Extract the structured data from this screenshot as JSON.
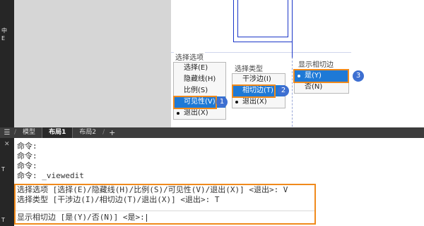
{
  "left_strip": {
    "glyphs": [
      "中",
      "E",
      "T",
      "T"
    ]
  },
  "menus": {
    "select_options": {
      "caption": "选择选项",
      "items": [
        {
          "label": "选择(E)",
          "selected": false,
          "dot": false
        },
        {
          "label": "隐藏线(H)",
          "selected": false,
          "dot": false
        },
        {
          "label": "比例(S)",
          "selected": false,
          "dot": false
        },
        {
          "label": "可见性(V)",
          "selected": true,
          "dot": false
        },
        {
          "label": "退出(X)",
          "selected": false,
          "dot": true
        }
      ]
    },
    "select_type": {
      "caption": "选择类型",
      "items": [
        {
          "label": "干涉边(I)",
          "selected": false,
          "dot": false
        },
        {
          "label": "相切边(T)",
          "selected": true,
          "dot": false
        },
        {
          "label": "退出(X)",
          "selected": false,
          "dot": true
        }
      ]
    },
    "show_tangent": {
      "caption": "显示相切边",
      "items": [
        {
          "label": "是(Y)",
          "selected": true,
          "dot": true
        },
        {
          "label": "否(N)",
          "selected": false,
          "dot": false
        }
      ]
    }
  },
  "badges": [
    "1",
    "2",
    "3"
  ],
  "tabbar": {
    "menu_icon": "hamburger-icon",
    "tabs": [
      {
        "label": "模型",
        "active": false
      },
      {
        "label": "布局1",
        "active": true
      },
      {
        "label": "布局2",
        "active": false
      }
    ],
    "add_label": "+"
  },
  "command": {
    "close_icon": "close-icon",
    "history": [
      "命令:",
      "命令:",
      "命令:",
      "命令: _viewedit"
    ],
    "line_select_options": "选择选项 [选择(E)/隐藏线(H)/比例(S)/可见性(V)/退出(X)] <退出>: V",
    "line_select_type": "选择类型 [干涉边(I)/相切边(T)/退出(X)] <退出>: T",
    "prompt": "显示相切边 [是(Y)/否(N)] <是>:"
  },
  "colors": {
    "accent": "#1e79d6",
    "highlight": "#f08a1c",
    "badge": "#3d6fd1",
    "drawing": "#1b36c8"
  }
}
